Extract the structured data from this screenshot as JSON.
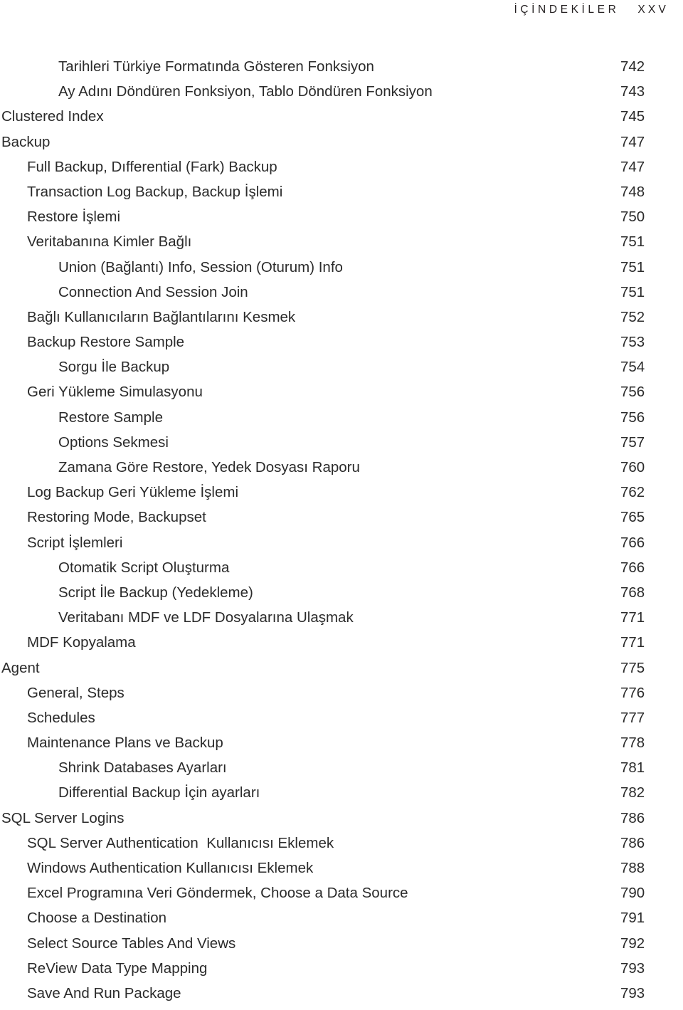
{
  "header": {
    "title": "İÇİNDEKİLER",
    "folio": "XXV"
  },
  "toc": {
    "entries": [
      {
        "title": "Tarihleri Türkiye Formatında Gösteren Fonksiyon",
        "page": "742",
        "level": 2
      },
      {
        "title": "Ay Adını Döndüren Fonksiyon, Tablo Döndüren Fonksiyon",
        "page": "743",
        "level": 2
      },
      {
        "title": "Clustered Index",
        "page": "745",
        "level": 0
      },
      {
        "title": "Backup",
        "page": "747",
        "level": 0
      },
      {
        "title": "Full Backup, Dıfferential (Fark) Backup",
        "page": "747",
        "level": 1
      },
      {
        "title": "Transaction Log Backup, Backup İşlemi",
        "page": "748",
        "level": 1
      },
      {
        "title": "Restore İşlemi",
        "page": "750",
        "level": 1
      },
      {
        "title": "Veritabanına Kimler Bağlı",
        "page": "751",
        "level": 1
      },
      {
        "title": "Union (Bağlantı) Info, Session (Oturum) Info",
        "page": "751",
        "level": 2
      },
      {
        "title": "Connection And Session Join",
        "page": "751",
        "level": 2
      },
      {
        "title": "Bağlı Kullanıcıların Bağlantılarını Kesmek",
        "page": "752",
        "level": 1
      },
      {
        "title": "Backup Restore Sample",
        "page": "753",
        "level": 1
      },
      {
        "title": "Sorgu İle Backup",
        "page": "754",
        "level": 2
      },
      {
        "title": "Geri Yükleme Simulasyonu",
        "page": "756",
        "level": 1
      },
      {
        "title": "Restore Sample",
        "page": "756",
        "level": 2
      },
      {
        "title": "Options Sekmesi",
        "page": "757",
        "level": 2
      },
      {
        "title": "Zamana Göre Restore, Yedek Dosyası Raporu",
        "page": "760",
        "level": 2
      },
      {
        "title": "Log Backup Geri Yükleme İşlemi",
        "page": "762",
        "level": 1
      },
      {
        "title": "Restoring Mode, Backupset",
        "page": "765",
        "level": 1
      },
      {
        "title": "Script İşlemleri",
        "page": "766",
        "level": 1
      },
      {
        "title": "Otomatik Script Oluşturma",
        "page": "766",
        "level": 2
      },
      {
        "title": "Script İle Backup (Yedekleme)",
        "page": "768",
        "level": 2
      },
      {
        "title": "Veritabanı MDF ve LDF Dosyalarına Ulaşmak",
        "page": "771",
        "level": 2
      },
      {
        "title": "MDF Kopyalama",
        "page": "771",
        "level": 1
      },
      {
        "title": "Agent",
        "page": "775",
        "level": 0
      },
      {
        "title": "General, Steps",
        "page": "776",
        "level": 1
      },
      {
        "title": "Schedules",
        "page": "777",
        "level": 1
      },
      {
        "title": "Maintenance Plans ve Backup",
        "page": "778",
        "level": 1
      },
      {
        "title": "Shrink Databases Ayarları",
        "page": "781",
        "level": 2
      },
      {
        "title": "Differential Backup İçin ayarları",
        "page": "782",
        "level": 2
      },
      {
        "title": "SQL Server Logins",
        "page": "786",
        "level": 0
      },
      {
        "title": "SQL Server Authentication  Kullanıcısı Eklemek",
        "page": "786",
        "level": 1
      },
      {
        "title": "Windows Authentication Kullanıcısı Eklemek",
        "page": "788",
        "level": 1
      },
      {
        "title": "Excel Programına Veri Göndermek, Choose a Data Source",
        "page": "790",
        "level": 1
      },
      {
        "title": "Choose a Destination",
        "page": "791",
        "level": 1
      },
      {
        "title": "Select Source Tables And Views",
        "page": "792",
        "level": 1
      },
      {
        "title": "ReView Data Type Mapping",
        "page": "793",
        "level": 1
      },
      {
        "title": "Save And Run Package",
        "page": "793",
        "level": 1
      }
    ]
  }
}
